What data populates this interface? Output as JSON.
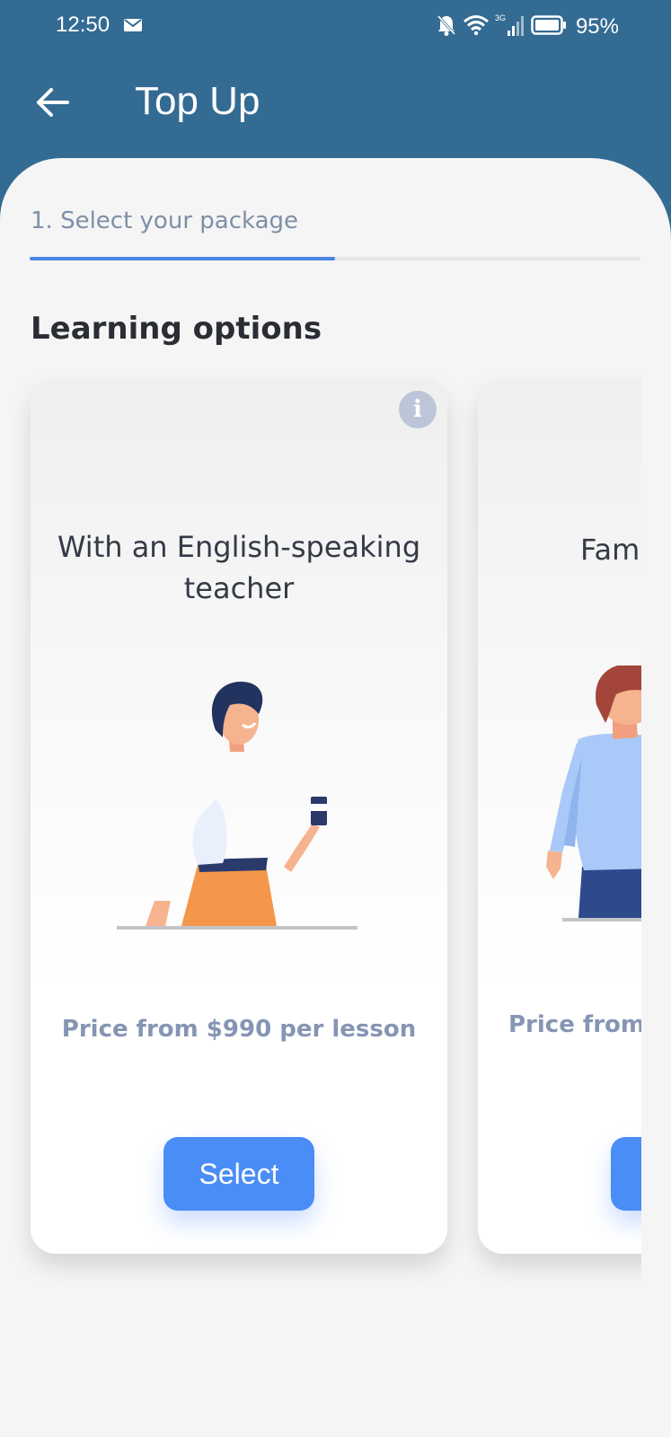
{
  "status_bar": {
    "time": "12:50",
    "battery_percent": "95%",
    "network_label": "3G",
    "icons": [
      "mail-icon",
      "bell-off-icon",
      "wifi-icon",
      "signal-icon",
      "battery-icon"
    ]
  },
  "app_bar": {
    "title": "Top Up",
    "back_icon": "arrow-left-icon"
  },
  "step": {
    "label": "1. Select your package",
    "progress": 0.5
  },
  "section_title": "Learning options",
  "cards": [
    {
      "title": "With an English-speaking teacher",
      "price": "Price from $990 per lesson",
      "button_label": "Select",
      "info_icon": "info-icon"
    },
    {
      "title": "Fam",
      "price": "Price from",
      "button_label": ""
    }
  ],
  "colors": {
    "header_bg": "#336b93",
    "sheet_bg": "#f5f5f6",
    "accent": "#4b8df7",
    "progress": "#4a85e4",
    "price_text": "#8595b3"
  }
}
